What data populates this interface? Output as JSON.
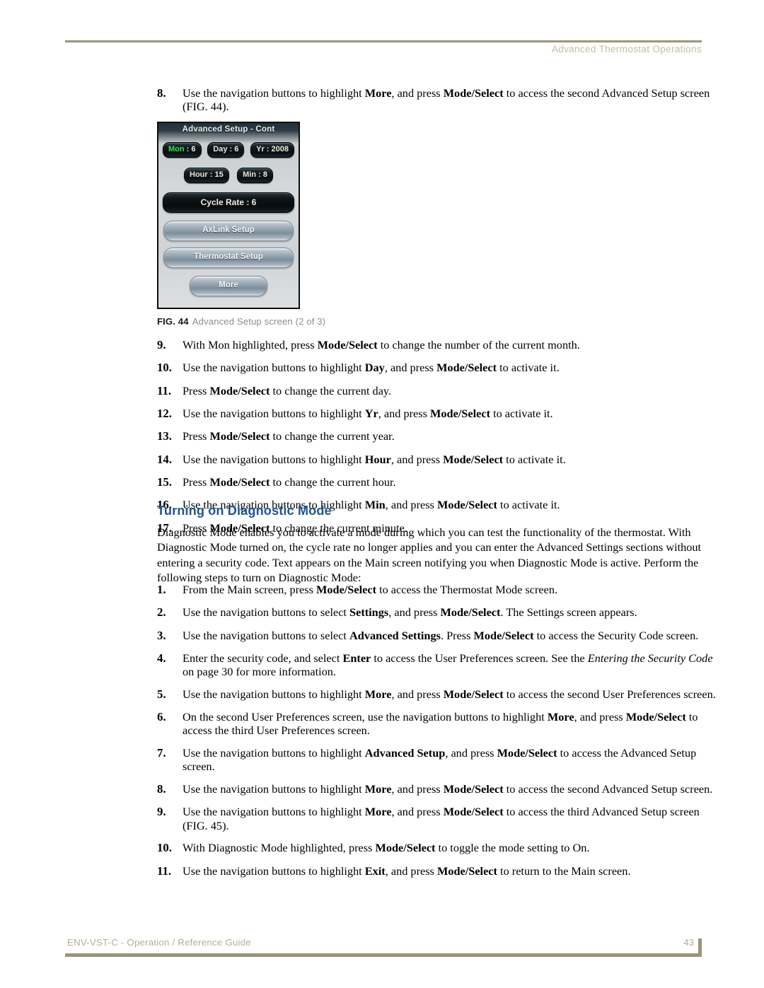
{
  "header": {
    "title": "Advanced Thermostat Operations",
    "rule_color": "#9b9579"
  },
  "footer": {
    "guide_title": "ENV-VST-C - Operation / Reference Guide",
    "page_number": "43",
    "rule_color": "#9b9579"
  },
  "top_list": {
    "items": [
      {
        "num": "8.",
        "html": "Use the navigation buttons to highlight <b>More</b>, and press <b>Mode/Select</b> to access the second Advanced Setup screen (FIG. 44)."
      }
    ]
  },
  "figure": {
    "caption_number": "FIG. 44",
    "caption_text": "Advanced Setup screen (2 of 3)",
    "screen": {
      "title": "Advanced Setup - Cont",
      "highlight_color": "#35e54a",
      "value_color": "#efe9cf",
      "date_row": [
        {
          "label": "Mon",
          "sep": " : ",
          "value": "6",
          "highlighted": true
        },
        {
          "label": "Day",
          "sep": " : ",
          "value": "6",
          "highlighted": false
        },
        {
          "label": "Yr",
          "sep": " : ",
          "value": "2008",
          "highlighted": false
        }
      ],
      "time_row": [
        {
          "label": "Hour",
          "sep": " : ",
          "value": "15",
          "highlighted": false
        },
        {
          "label": "Min",
          "sep": " : ",
          "value": "8",
          "highlighted": false
        }
      ],
      "cycle_rate": "Cycle Rate : 6",
      "buttons": [
        {
          "label": "AxLink Setup"
        },
        {
          "label": "Thermostat Setup"
        },
        {
          "label": "More"
        }
      ]
    }
  },
  "mid_list": {
    "items": [
      {
        "num": "9.",
        "html": "With Mon highlighted, press <b>Mode/Select</b> to change the number of the current month."
      },
      {
        "num": "10.",
        "html": "Use the navigation buttons to highlight <b>Day</b>, and press <b>Mode/Select</b> to activate it."
      },
      {
        "num": "11.",
        "html": "Press <b>Mode/Select</b> to change the current day."
      },
      {
        "num": "12.",
        "html": "Use the navigation buttons to highlight <b>Yr</b>, and press <b>Mode/Select</b> to activate it."
      },
      {
        "num": "13.",
        "html": "Press <b>Mode/Select</b> to change the current year."
      },
      {
        "num": "14.",
        "html": "Use the navigation buttons to highlight <b>Hour</b>, and press <b>Mode/Select</b> to activate it."
      },
      {
        "num": "15.",
        "html": "Press <b>Mode/Select</b> to change the current hour."
      },
      {
        "num": "16.",
        "html": "Use the navigation buttons to highlight <b>Min</b>, and press <b>Mode/Select</b> to activate it."
      },
      {
        "num": "17.",
        "html": "Press <b>Mode/Select</b> to change the current minute."
      }
    ]
  },
  "section": {
    "heading": "Turning on Diagnostic Mode",
    "heading_color": "#20558f",
    "paragraph": "Diagnostic Mode enables you to activate a mode during which you can test the functionality of the thermostat. With Diagnostic Mode turned on, the cycle rate no longer applies and you can enter the Advanced Settings sections without entering a security code. Text appears on the Main screen notifying you when Diagnostic Mode is active. Perform the following steps to turn on Diagnostic Mode:"
  },
  "bottom_list": {
    "items": [
      {
        "num": "1.",
        "html": "From the Main screen, press <b>Mode/Select</b> to access the Thermostat Mode screen."
      },
      {
        "num": "2.",
        "html": "Use the navigation buttons to select <b>Settings</b>, and press <b>Mode/Select</b>. The Settings screen appears."
      },
      {
        "num": "3.",
        "html": "Use the navigation buttons to select <b>Advanced Settings</b>. Press <b>Mode/Select</b> to access the Security Code screen."
      },
      {
        "num": "4.",
        "html": "Enter the security code, and select <b>Enter</b> to access the User Preferences screen. See the <i>Entering the Security Code</i> on page 30 for more information."
      },
      {
        "num": "5.",
        "html": "Use the navigation buttons to highlight <b>More</b>, and press <b>Mode/Select</b> to access the second User Preferences screen."
      },
      {
        "num": "6.",
        "html": "On the second User Preferences screen, use the navigation buttons to highlight <b>More</b>, and press <b>Mode/Select</b> to access the third User Preferences screen."
      },
      {
        "num": "7.",
        "html": "Use the navigation buttons to highlight <b>Advanced Setup</b>, and press <b>Mode/Select</b> to access the Advanced Setup screen."
      },
      {
        "num": "8.",
        "html": "Use the navigation buttons to highlight <b>More</b>, and press <b>Mode/Select</b> to access the second Advanced Setup screen."
      },
      {
        "num": "9.",
        "html": "Use the navigation buttons to highlight <b>More</b>, and press <b>Mode/Select</b> to access the third Advanced Setup screen (FIG. 45)."
      },
      {
        "num": "10.",
        "html": "With Diagnostic Mode highlighted, press <b>Mode/Select</b> to toggle the mode setting to On."
      },
      {
        "num": "11.",
        "html": "Use the navigation buttons to highlight <b>Exit</b>, and press <b>Mode/Select</b> to return to the Main screen."
      }
    ]
  }
}
